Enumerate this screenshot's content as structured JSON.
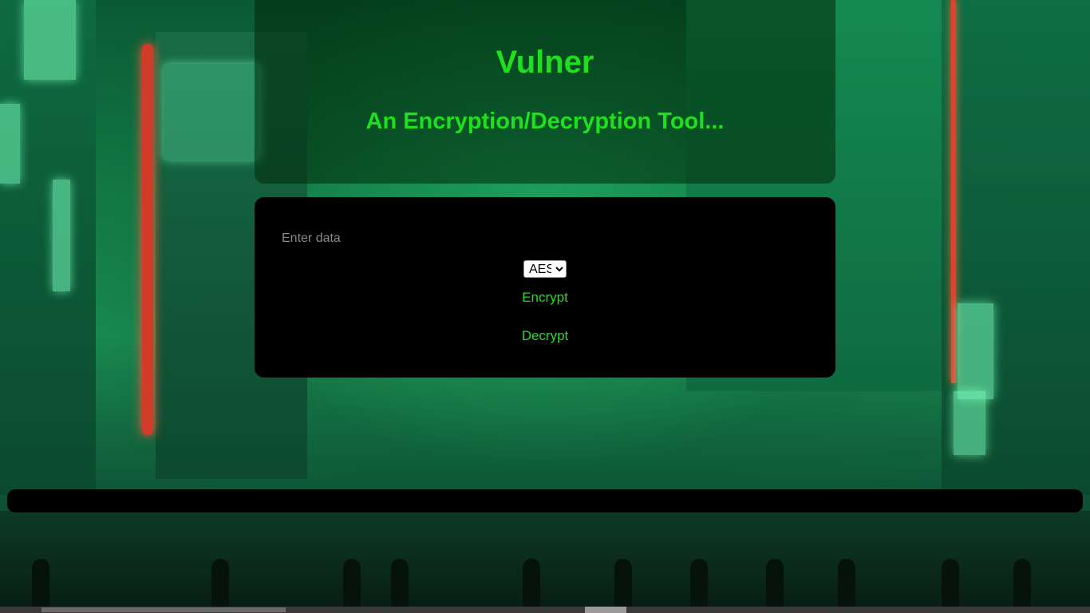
{
  "header": {
    "title": "Vulner",
    "subtitle": "An Encryption/Decryption Tool..."
  },
  "form": {
    "input_placeholder": "Enter data",
    "input_value": "",
    "algorithm_options": [
      "AES"
    ],
    "algorithm_selected": "AES",
    "encrypt_label": "Encrypt",
    "decrypt_label": "Decrypt"
  },
  "output": {
    "text": ""
  },
  "colors": {
    "accent": "#1ee01e",
    "panel": "#000000"
  }
}
